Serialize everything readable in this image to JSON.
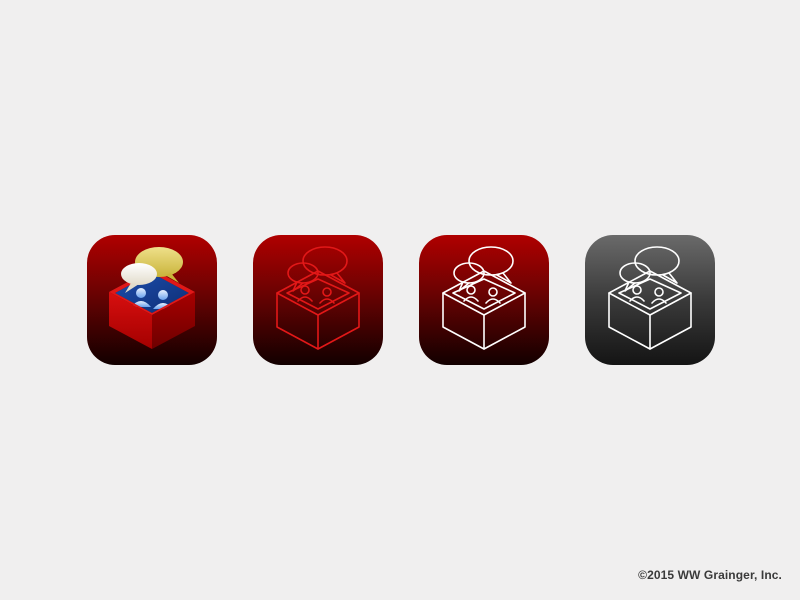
{
  "footer": {
    "copyright": "©2015 WW Grainger, Inc."
  },
  "icons": [
    {
      "style": "full-color",
      "background": "red-gradient"
    },
    {
      "style": "red-outline",
      "background": "red-gradient"
    },
    {
      "style": "white-outline",
      "background": "red-gradient"
    },
    {
      "style": "white-outline",
      "background": "gray-gradient"
    }
  ],
  "colors": {
    "page_background": "#f0efef",
    "brand_red": "#c40000",
    "outline_red": "#e21818",
    "outline_white": "#ffffff",
    "bubble_yellow": "#e6d465",
    "bubble_white": "#f5f1e6",
    "people_blue": "#3f7fd8",
    "text": "#3a3a3a"
  }
}
